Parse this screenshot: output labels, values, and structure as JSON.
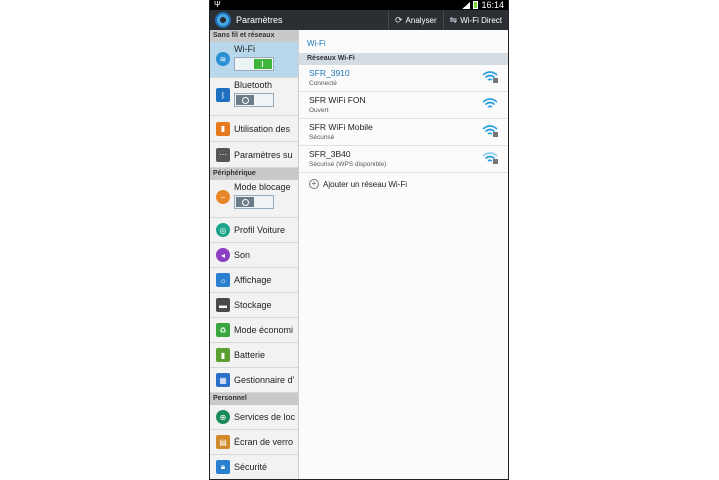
{
  "status_bar": {
    "time": "16:14",
    "usb_symbol": "Ψ"
  },
  "action_bar": {
    "title": "Paramètres",
    "actions": [
      {
        "label": "Analyser",
        "icon": "refresh-icon"
      },
      {
        "label": "Wi-Fi Direct",
        "icon": "wifi-direct-icon"
      }
    ]
  },
  "sidebar": {
    "sections": [
      {
        "header": "Sans fil et réseaux",
        "items": [
          {
            "label": "Wi-Fi",
            "icon": "wifi-icon",
            "toggle": "on",
            "selected": true
          },
          {
            "label": "Bluetooth",
            "icon": "bluetooth-icon",
            "toggle": "off"
          },
          {
            "label": "Utilisation des",
            "icon": "data-usage-icon"
          },
          {
            "label": "Paramètres su",
            "icon": "more-settings-icon"
          }
        ]
      },
      {
        "header": "Périphérique",
        "items": [
          {
            "label": "Mode blocage",
            "icon": "blocking-mode-icon",
            "toggle": "off"
          },
          {
            "label": "Profil Voiture",
            "icon": "car-profile-icon"
          },
          {
            "label": "Son",
            "icon": "sound-icon"
          },
          {
            "label": "Affichage",
            "icon": "display-icon"
          },
          {
            "label": "Stockage",
            "icon": "storage-icon"
          },
          {
            "label": "Mode économi",
            "icon": "power-saving-icon"
          },
          {
            "label": "Batterie",
            "icon": "battery-icon"
          },
          {
            "label": "Gestionnaire d'",
            "icon": "app-manager-icon"
          }
        ]
      },
      {
        "header": "Personnel",
        "items": [
          {
            "label": "Services de loc",
            "icon": "location-icon"
          },
          {
            "label": "Écran de verro",
            "icon": "lock-screen-icon"
          },
          {
            "label": "Sécurité",
            "icon": "security-icon"
          }
        ]
      }
    ]
  },
  "wifi_panel": {
    "title": "Wi-Fi",
    "section_header": "Réseaux Wi-Fi",
    "networks": [
      {
        "name": "SFR_3910",
        "status": "Connecté",
        "connected": true,
        "locked": true
      },
      {
        "name": "SFR WiFi FON",
        "status": "Ouvert",
        "connected": false,
        "locked": false
      },
      {
        "name": "SFR WiFi Mobile",
        "status": "Sécurisé",
        "connected": false,
        "locked": true
      },
      {
        "name": "SFR_3B40",
        "status": "Sécurisé (WPS disponible)",
        "connected": false,
        "locked": true
      }
    ],
    "add_network_label": "Ajouter un réseau Wi-Fi"
  },
  "colors": {
    "accent_blue": "#1a77b8",
    "action_bar": "#2b2f34",
    "toggle_on": "#3fb63a",
    "selected_row": "#b8d7ea"
  }
}
